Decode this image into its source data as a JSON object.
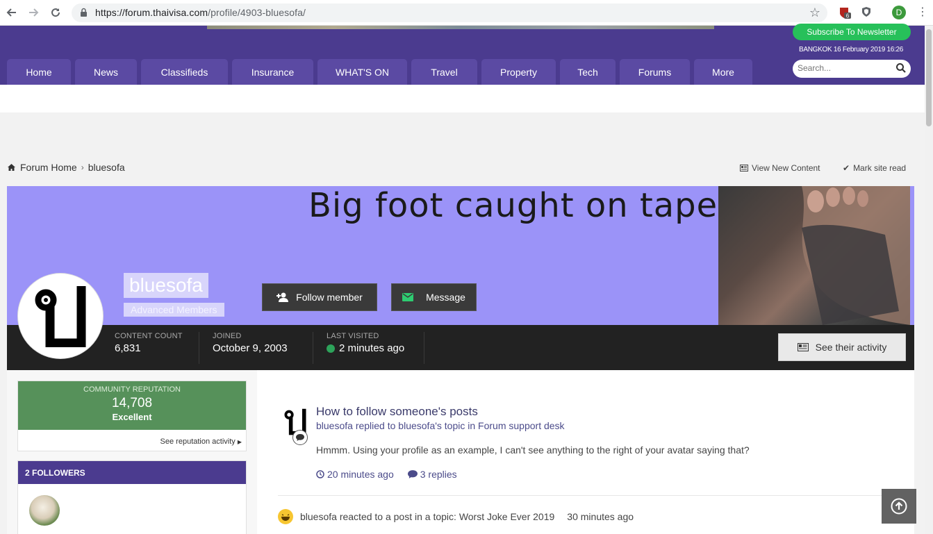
{
  "browser": {
    "url_host": "https://forum.thaivisa.com",
    "url_path": "/profile/4903-bluesofa/",
    "ext_badge": "6",
    "profile_initial": "D"
  },
  "header": {
    "subscribe_label": "Subscribe To Newsletter",
    "dateline": "BANGKOK 16 February 2019 16:26",
    "search_placeholder": "Search...",
    "nav": [
      "Home",
      "News",
      "Classifieds",
      "Insurance",
      "WHAT'S ON",
      "Travel",
      "Property",
      "Tech",
      "Forums",
      "More"
    ],
    "colors": {
      "brand": "#4b3b8f",
      "tab": "#5b4aa3",
      "subscribe": "#27c05a"
    }
  },
  "breadcrumb": {
    "home": "Forum Home",
    "current": "bluesofa",
    "view_new": "View New Content",
    "mark_read": "Mark site read"
  },
  "profile": {
    "cover_title": "Big foot caught on tape",
    "name": "bluesofa",
    "group": "Advanced Members",
    "follow_label": "Follow member",
    "message_label": "Message",
    "stats": {
      "content_label": "CONTENT COUNT",
      "content_value": "6,831",
      "joined_label": "JOINED",
      "joined_value": "October 9, 2003",
      "visited_label": "LAST VISITED",
      "visited_value": "2 minutes ago"
    },
    "activity_label": "See their activity",
    "avatar_glyph": "ป"
  },
  "sidebar": {
    "rep_label": "COMMUNITY REPUTATION",
    "rep_value": "14,708",
    "rep_word": "Excellent",
    "rep_link": "See reputation activity",
    "followers_title": "2 FOLLOWERS"
  },
  "feed": {
    "item1": {
      "title": "How to follow someone's posts",
      "sub": "bluesofa replied to bluesofa's topic in Forum support desk",
      "body": "Hmmm. Using your profile as an example, I can't see anything to the right of your avatar saying that?",
      "time": "20 minutes ago",
      "replies": "3 replies"
    },
    "item2": {
      "text": "bluesofa reacted to a post in a topic: Worst Joke Ever 2019",
      "time": "30 minutes ago"
    }
  }
}
